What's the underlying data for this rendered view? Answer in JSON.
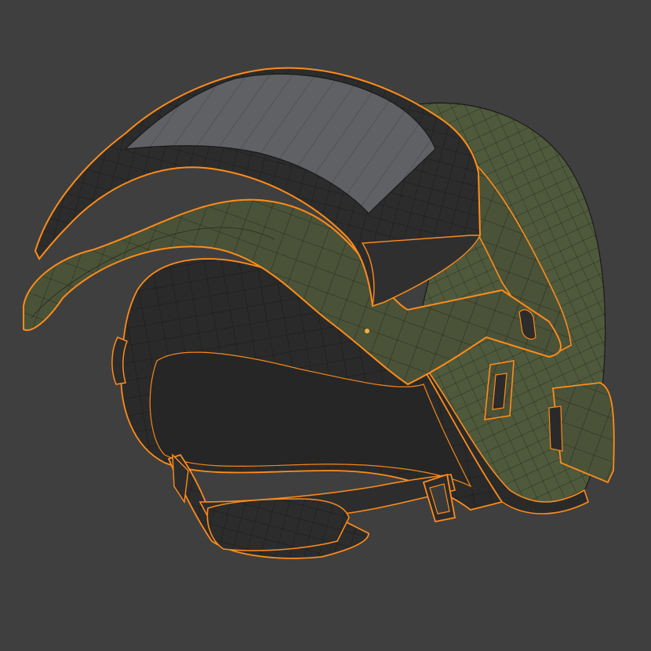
{
  "scene": {
    "colors": {
      "background": "#3f3f3f",
      "olive_shell": "#4a5238",
      "olive_light": "#586343",
      "dark_pad": "#2b2b2b",
      "dark_pad_light": "#333333",
      "visor_glass": "#5e6063",
      "edge_select": "#ff8c1a",
      "wire": "#1a1a1a"
    },
    "objects": [
      "helmet-shell",
      "visor",
      "visor-glass",
      "brim",
      "inner-padding",
      "ear-pad",
      "chin-strap",
      "strap-buckle",
      "side-clip",
      "side-mount",
      "rear-clip"
    ]
  }
}
